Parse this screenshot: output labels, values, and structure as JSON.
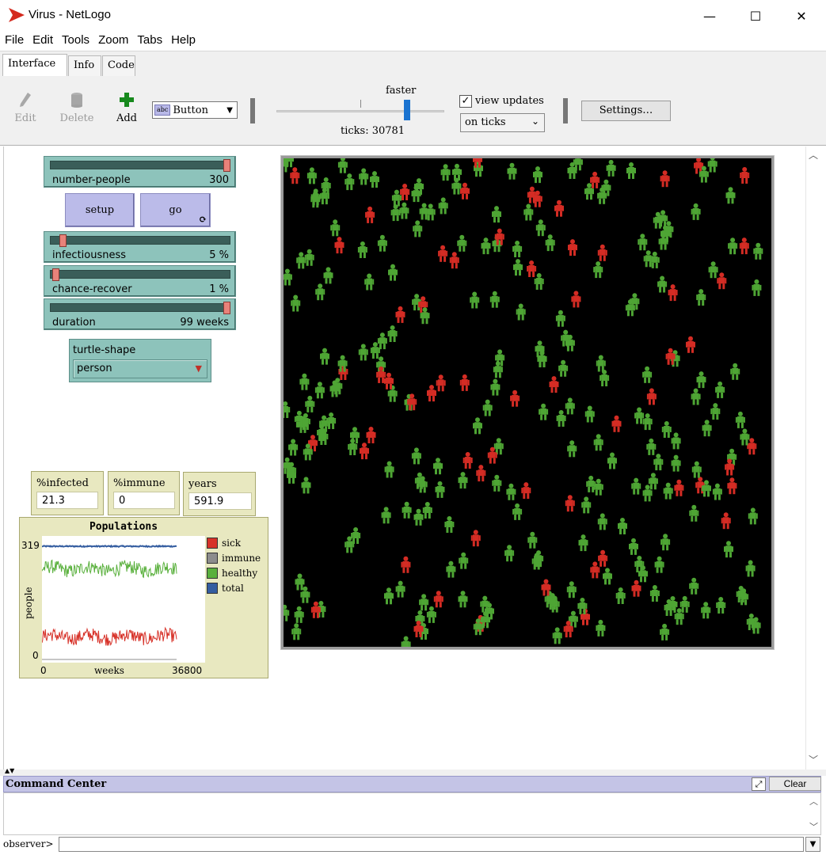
{
  "window": {
    "title": "Virus - NetLogo",
    "minimize_glyph": "—",
    "maximize_glyph": "☐",
    "close_glyph": "✕"
  },
  "menubar": {
    "items": [
      "File",
      "Edit",
      "Tools",
      "Zoom",
      "Tabs",
      "Help"
    ]
  },
  "tabs": [
    "Interface",
    "Info",
    "Code"
  ],
  "toolbar": {
    "edit_label": "Edit",
    "delete_label": "Delete",
    "add_label": "Add",
    "widget_type": "Button",
    "speed_label": "faster",
    "speed_fraction": 0.8,
    "ticks_label": "ticks: 30781",
    "view_updates_label": "view updates",
    "view_updates_checked": true,
    "update_mode": "on ticks",
    "settings_label": "Settings…"
  },
  "sliders": [
    {
      "name": "number-people",
      "value": "300",
      "fraction": 1.0
    },
    {
      "name": "infectiousness",
      "value": "5 %",
      "fraction": 0.05
    },
    {
      "name": "chance-recover",
      "value": "1 %",
      "fraction": 0.01
    },
    {
      "name": "duration",
      "value": "99 weeks",
      "fraction": 1.0
    }
  ],
  "buttons": {
    "setup_label": "setup",
    "go_label": "go"
  },
  "chooser": {
    "label": "turtle-shape",
    "value": "person"
  },
  "monitors": [
    {
      "label": "%infected",
      "value": "21.3"
    },
    {
      "label": "%immune",
      "value": "0"
    },
    {
      "label": "years",
      "value": "591.9"
    }
  ],
  "plot": {
    "title": "Populations",
    "y_max_label": "319",
    "y_min_label": "0",
    "x_min_label": "0",
    "x_max_label": "36800",
    "xlabel": "weeks",
    "ylabel": "people",
    "legend": [
      {
        "name": "sick",
        "color": "#d73229"
      },
      {
        "name": "immune",
        "color": "#8d8d8d"
      },
      {
        "name": "healthy",
        "color": "#59b03c"
      },
      {
        "name": "total",
        "color": "#345da0"
      }
    ]
  },
  "chart_data": {
    "type": "line",
    "title": "Populations",
    "xlabel": "weeks",
    "ylabel": "people",
    "xlim": [
      0,
      36800
    ],
    "ylim": [
      0,
      319
    ],
    "series": [
      {
        "name": "total",
        "color": "#345da0",
        "approx_level": 300
      },
      {
        "name": "healthy",
        "color": "#59b03c",
        "approx_level": 240
      },
      {
        "name": "sick",
        "color": "#d73229",
        "approx_level": 60
      },
      {
        "name": "immune",
        "color": "#8d8d8d",
        "approx_level": 0
      }
    ]
  },
  "world": {
    "background": "#000000",
    "healthy_color": "#4ea534",
    "sick_color": "#d42c24",
    "healthy_count": 236,
    "sick_count": 64
  },
  "command_center": {
    "title": "Command Center",
    "clear_label": "Clear",
    "prompt": "observer>"
  }
}
